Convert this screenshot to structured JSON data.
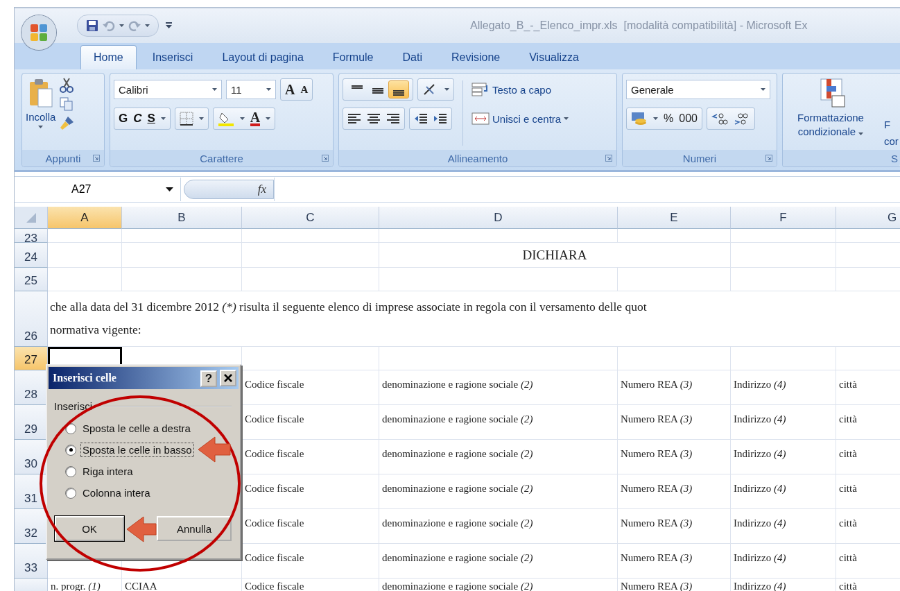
{
  "window": {
    "title": "Allegato_B_-_Elenco_impr.xls  [modalità compatibilità] - Microsoft Ex"
  },
  "tabs": [
    {
      "label": "Home",
      "selected": true
    },
    {
      "label": "Inserisci",
      "selected": false
    },
    {
      "label": "Layout di pagina",
      "selected": false
    },
    {
      "label": "Formule",
      "selected": false
    },
    {
      "label": "Dati",
      "selected": false
    },
    {
      "label": "Revisione",
      "selected": false
    },
    {
      "label": "Visualizza",
      "selected": false
    }
  ],
  "ribbon": {
    "clipboard": {
      "label": "Appunti",
      "paste": "Incolla"
    },
    "font": {
      "label": "Carattere",
      "font": "Calibri",
      "size": "11",
      "grow": "A",
      "shrink": "A",
      "bold": "G",
      "italic": "C",
      "underline": "S",
      "font_color": "A"
    },
    "alignment": {
      "label": "Allineamento",
      "vertical": [
        {
          "selected": false
        },
        {
          "selected": false
        },
        {
          "selected": true
        }
      ],
      "wrap": "Testo a capo",
      "merge": "Unisci e centra"
    },
    "number": {
      "label": "Numeri",
      "format": "Generale",
      "percent": "%",
      "thousands": "000"
    },
    "styles": {
      "label": "S",
      "conditional": "Formattazione condizionale",
      "next_button": [
        "F",
        "cor"
      ]
    }
  },
  "formula_bar": {
    "name_box": "A27",
    "function_label": "fx"
  },
  "columns": [
    {
      "label": "A",
      "selected": true
    },
    {
      "label": "B",
      "selected": false
    },
    {
      "label": "C",
      "selected": false
    },
    {
      "label": "D",
      "selected": false
    },
    {
      "label": "E",
      "selected": false
    },
    {
      "label": "F",
      "selected": false
    },
    {
      "label": "G",
      "selected": false
    }
  ],
  "rows": [
    {
      "number": "23",
      "kind": "partial",
      "selected": false
    },
    {
      "number": "24",
      "kind": "title",
      "selected": false,
      "text": "DICHIARA"
    },
    {
      "number": "25",
      "kind": "blank",
      "selected": false
    },
    {
      "number": "26",
      "kind": "paragraph",
      "selected": false,
      "before": "che alla data del 31 dicembre 2012 ",
      "italic": "(*)",
      "after": " risulta il seguente elenco di imprese associate in regola con il versamento delle quot",
      "continuation": "normativa vigente:"
    },
    {
      "number": "27",
      "kind": "blank",
      "selected": true
    },
    {
      "number": "28",
      "kind": "record",
      "selected": false,
      "cells": [
        "Codice fiscale",
        "denominazione e ragione sociale *(2)*",
        "Numero REA *(3)*",
        "Indirizzo *(4)*",
        "città"
      ]
    },
    {
      "number": "29",
      "kind": "record",
      "selected": false,
      "cells": [
        "Codice fiscale",
        "denominazione e ragione sociale *(2)*",
        "Numero REA *(3)*",
        "Indirizzo *(4)*",
        "città"
      ]
    },
    {
      "number": "30",
      "kind": "record",
      "selected": false,
      "cells": [
        "Codice fiscale",
        "denominazione e ragione sociale *(2)*",
        "Numero REA *(3)*",
        "Indirizzo *(4)*",
        "città"
      ]
    },
    {
      "number": "31",
      "kind": "record",
      "selected": false,
      "cells": [
        "Codice fiscale",
        "denominazione e ragione sociale *(2)*",
        "Numero REA *(3)*",
        "Indirizzo *(4)*",
        "città"
      ]
    },
    {
      "number": "32",
      "kind": "record",
      "selected": false,
      "cells": [
        "Codice fiscale",
        "denominazione e ragione sociale *(2)*",
        "Numero REA *(3)*",
        "Indirizzo *(4)*",
        "città"
      ]
    },
    {
      "number": "33",
      "kind": "record",
      "selected": false,
      "cells": [
        "Codice fiscale",
        "denominazione e ragione sociale *(2)*",
        "Numero REA *(3)*",
        "Indirizzo *(4)*",
        "città"
      ]
    },
    {
      "kind": "cut",
      "selected": false,
      "cells": [
        "n. progr. *(1)*",
        "CCIAA",
        "Codice fiscale",
        "denominazione e ragione sociale *(2)*",
        "Numero REA *(3)*",
        "Indirizzo *(4)*",
        "città"
      ]
    }
  ],
  "dialog": {
    "title": "Inserisci celle",
    "help": "?",
    "group": "Inserisci",
    "options": [
      {
        "label": "Sposta le celle a destra",
        "selected": false
      },
      {
        "label": "Sposta le celle in basso",
        "selected": true
      },
      {
        "label": "Riga intera",
        "selected": false
      },
      {
        "label": "Colonna intera",
        "selected": false
      }
    ],
    "buttons": [
      {
        "label": "OK",
        "default": true
      },
      {
        "label": "Annulla",
        "default": false
      }
    ]
  },
  "annotations": [
    {
      "kind": "ellipse"
    },
    {
      "kind": "arrow"
    },
    {
      "kind": "arrow"
    }
  ]
}
